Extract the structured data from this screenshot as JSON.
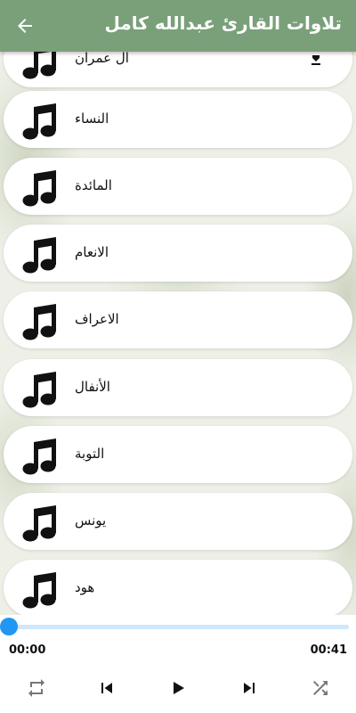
{
  "header": {
    "title": "تلاوات القارئ عبدالله كامل",
    "back_icon": "arrow-back-icon",
    "background_color": "#7aa07a"
  },
  "surahs": [
    {
      "name": "آل عمران",
      "icon": "music-note-icon",
      "download_icon": "download-icon"
    },
    {
      "name": "النساء",
      "icon": "music-note-icon"
    },
    {
      "name": "المائدة",
      "icon": "music-note-icon"
    },
    {
      "name": "الانعام",
      "icon": "music-note-icon"
    },
    {
      "name": "الاعراف",
      "icon": "music-note-icon"
    },
    {
      "name": "الأنفال",
      "icon": "music-note-icon"
    },
    {
      "name": "التوبة",
      "icon": "music-note-icon"
    },
    {
      "name": "يونس",
      "icon": "music-note-icon"
    },
    {
      "name": "هود",
      "icon": "music-note-icon"
    }
  ],
  "player": {
    "current_time": "00:00",
    "total_time": "00:41",
    "progress": 0,
    "accent_color": "#2196f3",
    "controls": [
      "repeat-icon",
      "skip-previous-icon",
      "play-icon",
      "skip-next-icon",
      "shuffle-icon"
    ]
  }
}
